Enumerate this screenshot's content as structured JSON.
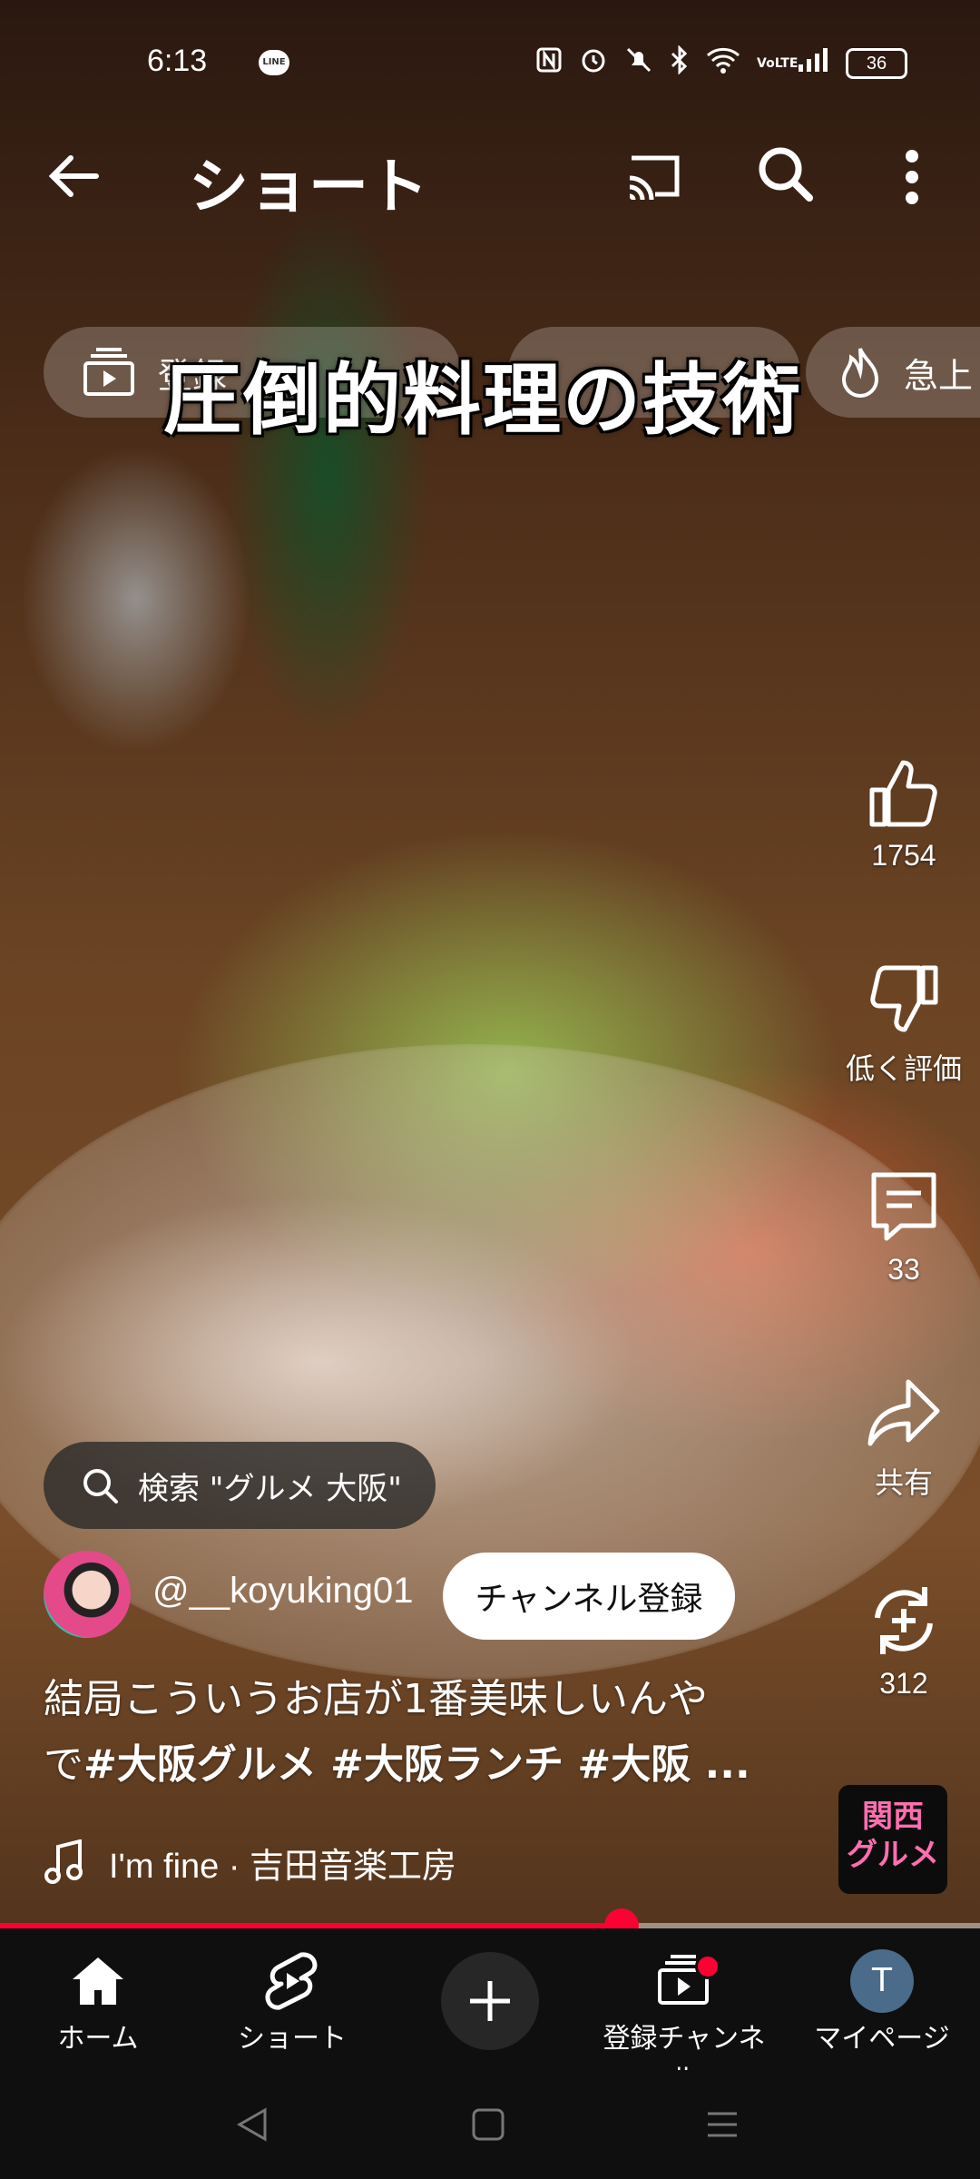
{
  "status_bar": {
    "time": "6:13",
    "line_label": "LINE",
    "network": "VoLTE",
    "battery": "36"
  },
  "app_bar": {
    "title": "ショート"
  },
  "chips": [
    {
      "label": "登録"
    },
    {
      "label": "急上"
    }
  ],
  "video": {
    "overlay_text": "圧倒的料理の技術"
  },
  "actions": {
    "like_count": "1754",
    "dislike_label": "低く評価",
    "comment_count": "33",
    "share_label": "共有",
    "remix_count": "312"
  },
  "search_suggestion": "検索 \"グルメ 大阪\"",
  "channel": {
    "handle": "@__koyuking01",
    "subscribe_label": "チャンネル登録"
  },
  "description": {
    "line1": "結局こういうお店が1番美味しいんや",
    "line2_prefix": "で",
    "hashtags": "#大阪グルメ #大阪ランチ #大阪 ..."
  },
  "music": {
    "track": "I'm fine · 吉田音楽工房"
  },
  "sound_badge": {
    "line1": "関西",
    "line2": "グルメ"
  },
  "playback": {
    "progress_fraction": 0.634
  },
  "bottom_nav": {
    "home": "ホーム",
    "shorts": "ショート",
    "subscriptions": "登録チャンネル",
    "you": "マイページ",
    "avatar_initial": "T"
  },
  "colors": {
    "accent": "#ff0033",
    "nav_bg": "#0f0f0f"
  }
}
